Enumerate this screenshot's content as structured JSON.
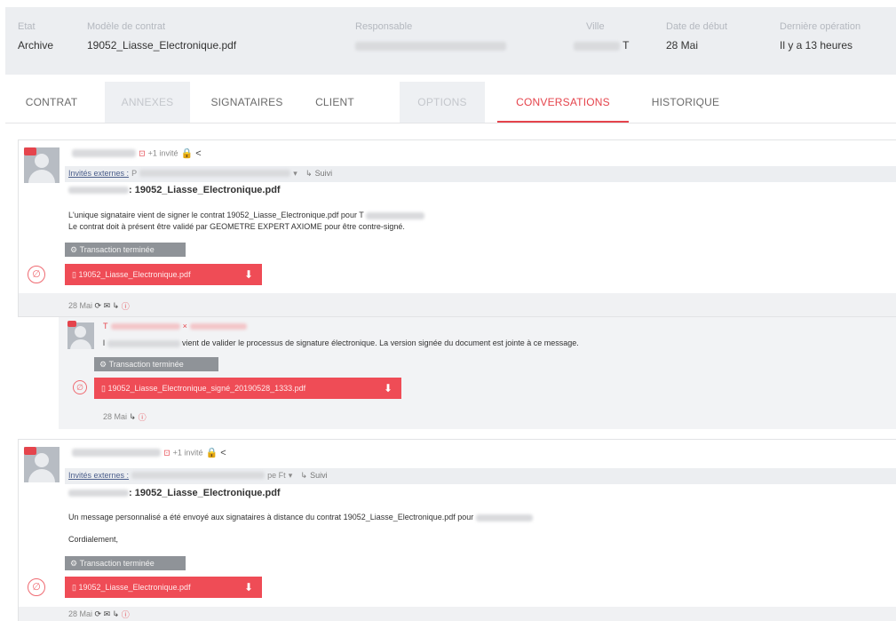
{
  "header": {
    "status_label": "Etat",
    "status_value": "Archive",
    "template_label": "Modèle de contrat",
    "template_value": "19052_Liasse_Electronique.pdf",
    "owner_label": "Responsable",
    "city_label": "Ville",
    "city_suffix": "T",
    "start_label": "Date de début",
    "start_value": "28 Mai",
    "last_label": "Dernière opération",
    "last_value": "Il y a 13 heures"
  },
  "tabs": [
    {
      "label": "CONTRAT",
      "state": "normal"
    },
    {
      "label": "ANNEXES",
      "state": "disabled"
    },
    {
      "label": "SIGNATAIRES",
      "state": "normal"
    },
    {
      "label": "CLIENT",
      "state": "normal"
    },
    {
      "label": "OPTIONS",
      "state": "disabled"
    },
    {
      "label": "CONVERSATIONS",
      "state": "active"
    },
    {
      "label": "HISTORIQUE",
      "state": "normal"
    }
  ],
  "messages": [
    {
      "invited": "+1 invité",
      "guests_label": "Invités externes :",
      "guests_prefix": "P",
      "follow_label": "Suivi",
      "subject": ": 19052_Liasse_Electronique.pdf",
      "body_line1": "L'unique signataire vient de signer le contrat 19052_Liasse_Electronique.pdf pour T",
      "body_line2": "Le contrat doit à présent être validé par GEOMETRE EXPERT AXIOME pour être contre-signé.",
      "badge": "Transaction terminée",
      "file": "19052_Liasse_Electronique.pdf",
      "date": "28 Mai"
    },
    {
      "initial": "T",
      "line_prefix": "l",
      "body": "vient de valider le processus de signature électronique. La version signée du document est jointe à ce message.",
      "badge": "Transaction terminée",
      "file": "19052_Liasse_Electronique_signé_20190528_1333.pdf",
      "date": "28 Mai"
    },
    {
      "invited": "+1 invité",
      "guests_label": "Invités externes :",
      "guests_suffix": "pe Ft",
      "follow_label": "Suivi",
      "subject": ": 19052_Liasse_Electronique.pdf",
      "body_line1": "Un message personnalisé a été envoyé aux signataires à distance du contrat 19052_Liasse_Electronique.pdf pour",
      "body_line2": "Cordialement,",
      "badge": "Transaction terminée",
      "file": "19052_Liasse_Electronique.pdf",
      "date": "28 Mai"
    }
  ],
  "icons": {
    "lock": "lock-icon",
    "share": "share-icon",
    "download": "download-icon",
    "attachment": "paperclip-icon",
    "settings": "gear-icon",
    "mail": "envelope-icon",
    "follow": "follow-icon",
    "info": "info-icon"
  },
  "colors": {
    "accent": "#e5444c",
    "file_button": "#ef4c56",
    "badge": "#8f9398",
    "header_bg": "#eceef1"
  }
}
